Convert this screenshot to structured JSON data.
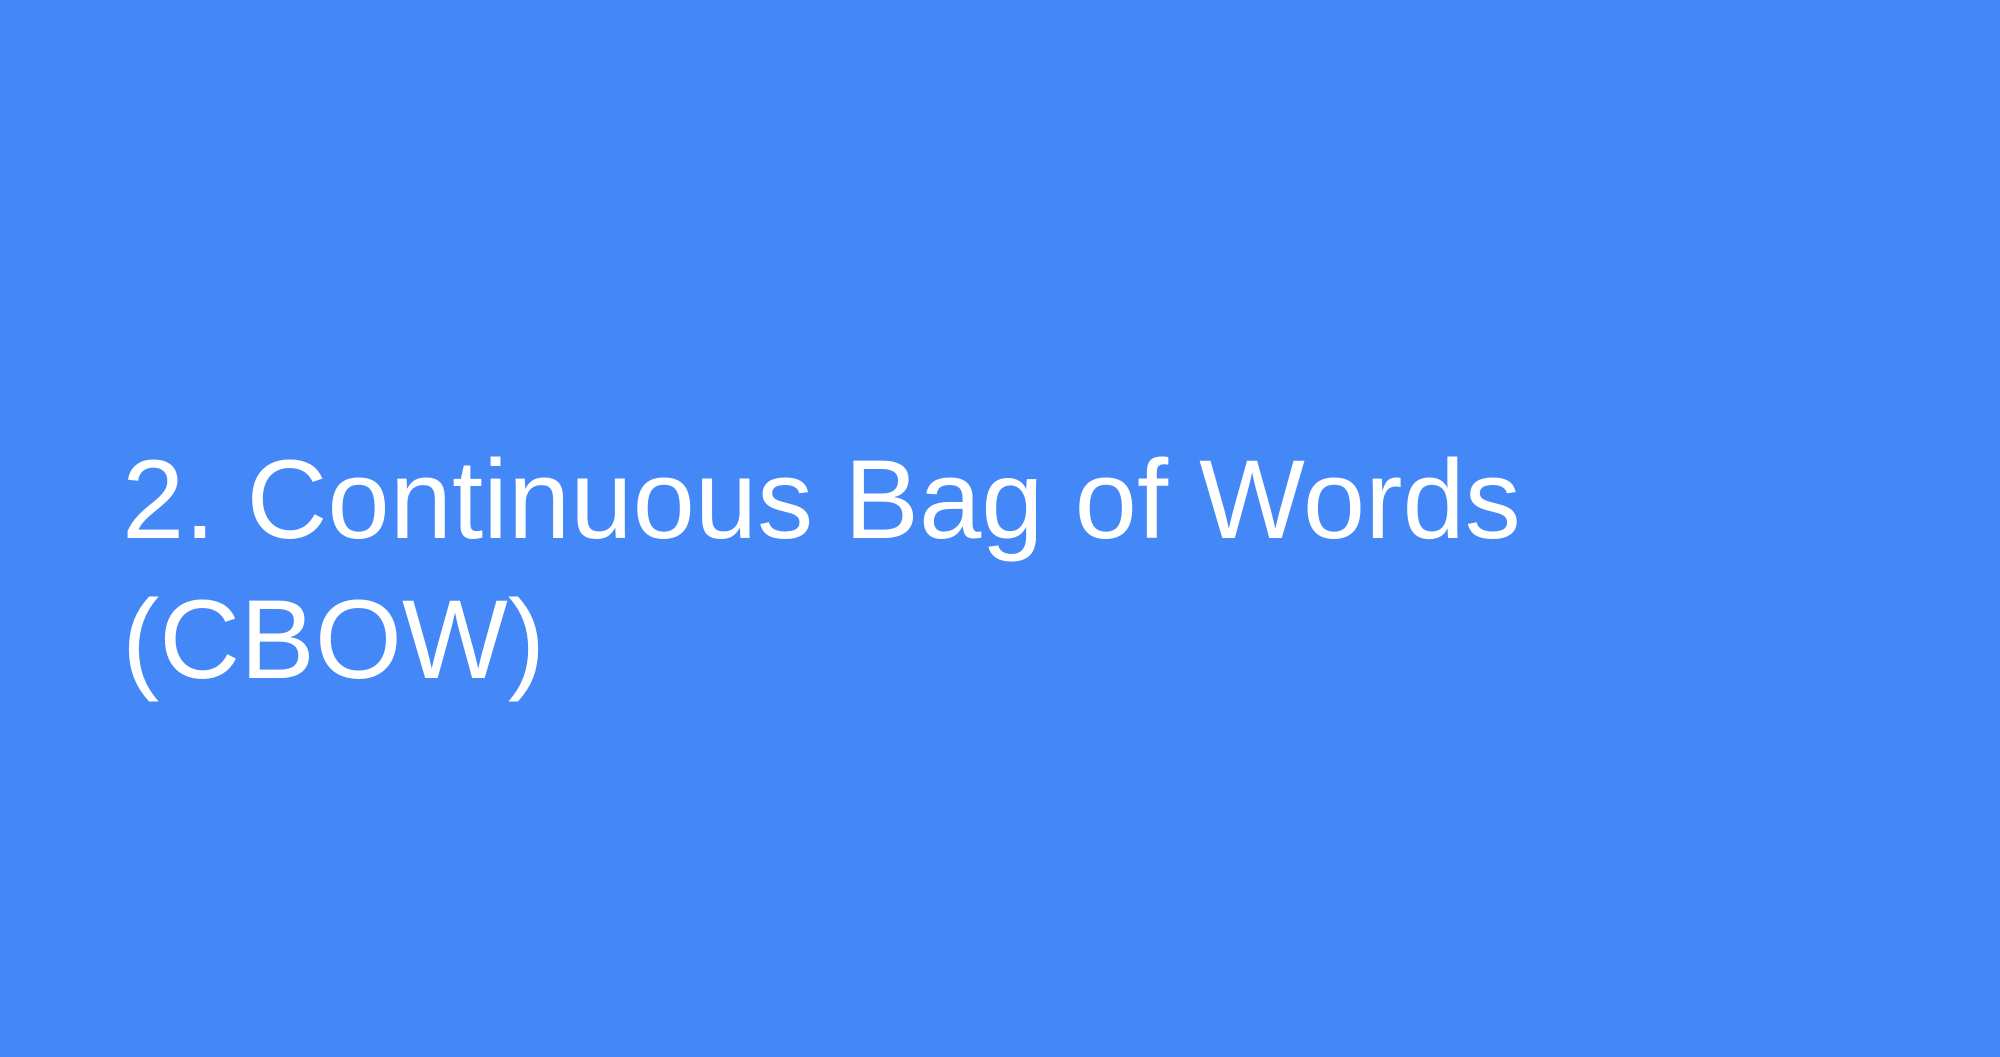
{
  "slide": {
    "background_color": "#4487f6",
    "text_color": "#ffffff",
    "title_lines": [
      "2. Continuous Bag of Words",
      "(CBOW)"
    ]
  }
}
